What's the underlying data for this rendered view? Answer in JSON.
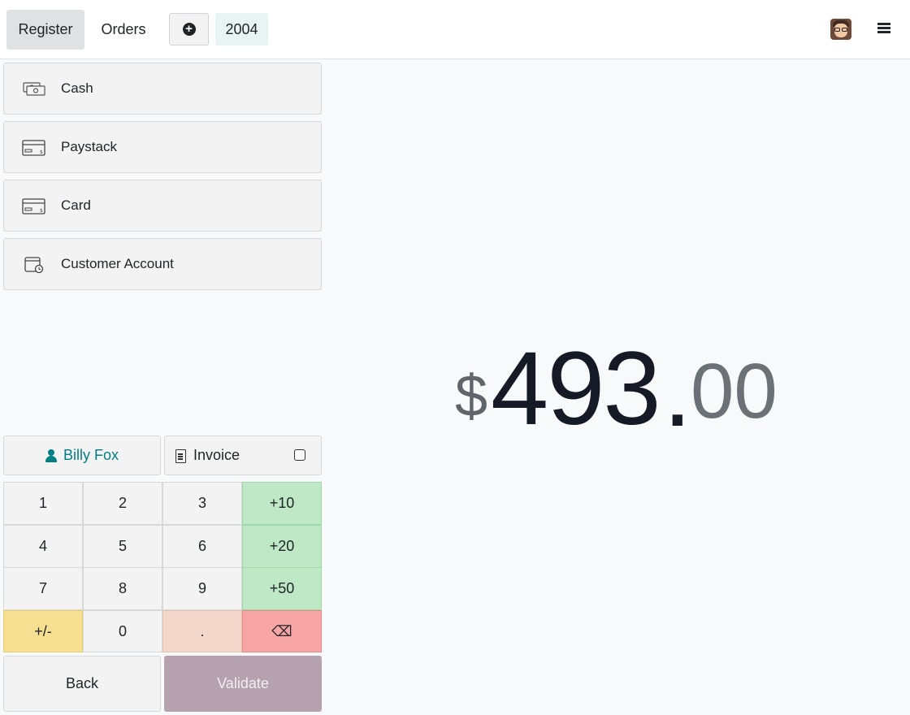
{
  "topbar": {
    "register_label": "Register",
    "orders_label": "Orders",
    "add_icon": "plus-circle-icon",
    "order_number": "2004",
    "menu_icon": "hamburger-menu-icon"
  },
  "payment_methods": [
    {
      "label": "Cash",
      "icon": "cash-icon"
    },
    {
      "label": "Paystack",
      "icon": "card-icon"
    },
    {
      "label": "Card",
      "icon": "card-icon"
    },
    {
      "label": "Customer Account",
      "icon": "customer-account-icon"
    }
  ],
  "customer": {
    "name": "Billy Fox",
    "color": "#017e84"
  },
  "invoice": {
    "label": "Invoice",
    "checked": false
  },
  "numpad": {
    "k1": "1",
    "k2": "2",
    "k3": "3",
    "k10": "+10",
    "k4": "4",
    "k5": "5",
    "k6": "6",
    "k20": "+20",
    "k7": "7",
    "k8": "8",
    "k9": "9",
    "k50": "+50",
    "sign": "+/-",
    "k0": "0",
    "dot": ".",
    "backspace": "⌫"
  },
  "actions": {
    "back_label": "Back",
    "validate_label": "Validate"
  },
  "amount": {
    "currency": "$",
    "integer": "493",
    "separator": ".",
    "decimals": "00"
  },
  "colors": {
    "validate": "#b5a2ae",
    "accent": "#017e84",
    "quick_add": "#bfe8c6",
    "delete": "#f7a5a5"
  }
}
